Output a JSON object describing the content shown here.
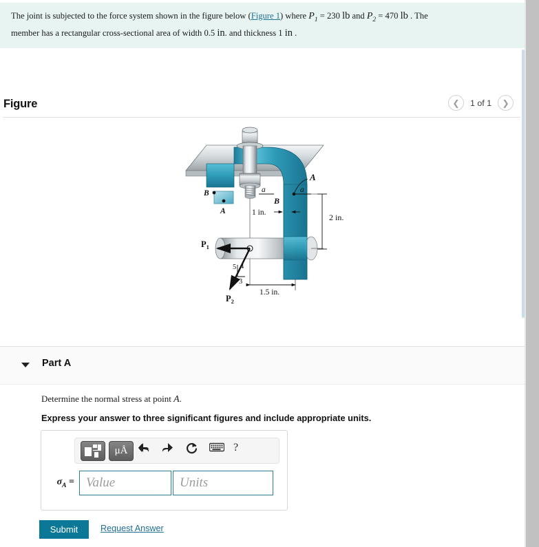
{
  "statement": {
    "line1_a": "The joint is subjected to the force system shown in the figure below (",
    "link": "Figure 1",
    "line1_b": ") where ",
    "p1_sym": "P",
    "p1_sub": "1",
    "p1_eq": " = 230 ",
    "p1_unit": "lb",
    "and": " and ",
    "p2_sym": "P",
    "p2_sub": "2",
    "p2_eq": " = 470 ",
    "p2_unit": "lb",
    "line1_c": " . The",
    "line2_a": "member has a rectangular cross-sectional area of width 0.5 ",
    "width_unit": "in",
    "line2_b": ". and thickness 1 ",
    "thick_unit": "in",
    "line2_c": " ."
  },
  "figure": {
    "title": "Figure",
    "prev_icon": "chevron-left-icon",
    "next_icon": "chevron-right-icon",
    "counter": "1 of 1",
    "labels": {
      "point_A_callout": "A",
      "point_B": "B",
      "inset_A": "A",
      "inset_B": "B",
      "section_a_left": "a",
      "section_a_right": "a",
      "dim_1in": "1 in.",
      "dim_2in": "2 in.",
      "dim_1_5in": "1.5 in.",
      "force_P1": "P",
      "force_P1_sub": "1",
      "force_P2": "P",
      "force_P2_sub": "2",
      "tri_5": "5",
      "tri_4": "4",
      "tri_3": "3"
    },
    "colors": {
      "member_teal": "#2f9cb8",
      "member_teal_dark": "#1b7f9c",
      "steel_light": "#e9ecee",
      "steel_mid": "#9aa2a7"
    }
  },
  "part": {
    "caret_icon": "caret-down-icon",
    "title": "Part A",
    "prompt_a": "Determine the normal stress at point ",
    "prompt_var": "A",
    "prompt_b": ".",
    "instruction": "Express your answer to three significant figures and include appropriate units."
  },
  "toolbar": {
    "template_icon": "template-layout-icon",
    "units_label": "μÅ",
    "undo_icon": "undo-arrow-icon",
    "undo_glyph": "↶",
    "redo_icon": "redo-arrow-icon",
    "redo_glyph": "↷",
    "reset_icon": "reset-circular-arrow-icon",
    "reset_glyph": "↻",
    "keyboard_icon": "keyboard-icon",
    "keyboard_glyph": "⌨",
    "help_icon": "question-mark-icon",
    "help_glyph": "?"
  },
  "answer": {
    "sigma_sym": "σ",
    "sigma_sub": "A",
    "equals": " =",
    "value_placeholder": "Value",
    "units_placeholder": "Units",
    "value_current": "",
    "units_current": ""
  },
  "actions": {
    "submit_label": "Submit",
    "request_label": "Request Answer",
    "submit_color": "#0b7897",
    "link_color": "#1f6f93"
  }
}
